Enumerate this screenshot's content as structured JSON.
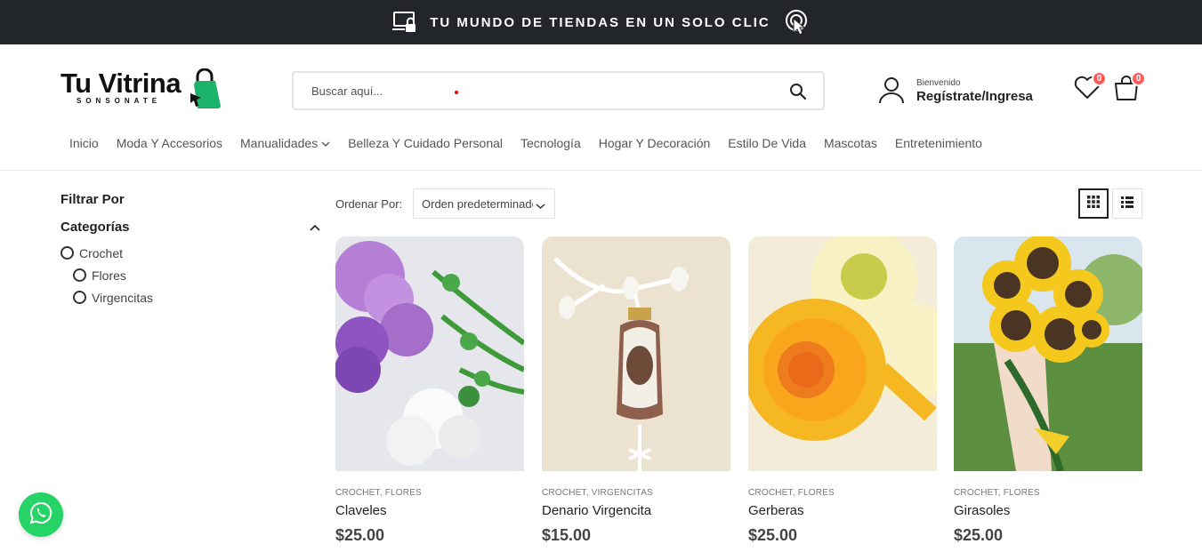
{
  "topbar": {
    "promo_text": "TU MUNDO DE TIENDAS EN UN SOLO CLIC",
    "bg": "#222529"
  },
  "logo": {
    "name": "Tu Vitrina",
    "subtitle": "SONSONATE",
    "bag_color": "#1bb36a"
  },
  "search": {
    "placeholder": "Buscar aquí..."
  },
  "account": {
    "welcome": "Bienvenido",
    "link": "Regístrate/Ingresa"
  },
  "wishlist": {
    "count": "0"
  },
  "cart": {
    "count": "0"
  },
  "nav": {
    "items": [
      {
        "label": "Inicio"
      },
      {
        "label": "Moda Y Accesorios"
      },
      {
        "label": "Manualidades",
        "has_dropdown": true
      },
      {
        "label": "Belleza Y Cuidado Personal"
      },
      {
        "label": "Tecnología"
      },
      {
        "label": "Hogar Y Decoración"
      },
      {
        "label": "Estilo De Vida"
      },
      {
        "label": "Mascotas"
      },
      {
        "label": "Entretenimiento"
      }
    ]
  },
  "sidebar": {
    "filter_title": "Filtrar Por",
    "categories_title": "Categorías",
    "categories": [
      {
        "label": "Crochet",
        "level": 0
      },
      {
        "label": "Flores",
        "level": 1
      },
      {
        "label": "Virgencitas",
        "level": 1
      }
    ]
  },
  "toolbar": {
    "sort_label": "Ordenar Por:",
    "sort_value": "Orden predeterminado"
  },
  "products": [
    {
      "categories": "CROCHET, FLORES",
      "name": "Claveles",
      "price": "$25.00"
    },
    {
      "categories": "CROCHET, VIRGENCITAS",
      "name": "Denario Virgencita",
      "price": "$15.00"
    },
    {
      "categories": "CROCHET, FLORES",
      "name": "Gerberas",
      "price": "$25.00"
    },
    {
      "categories": "CROCHET, FLORES",
      "name": "Girasoles",
      "price": "$25.00"
    }
  ],
  "colors": {
    "accent_badge": "#ff5b5b",
    "whatsapp": "#25d366",
    "text_dark": "#222529"
  }
}
